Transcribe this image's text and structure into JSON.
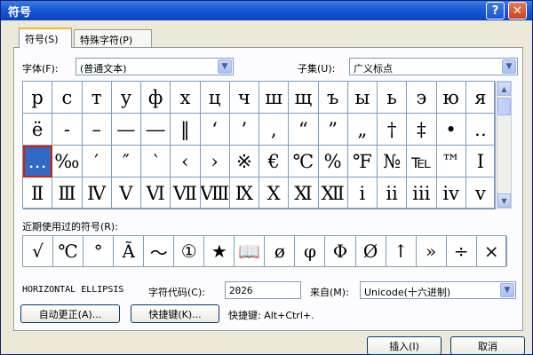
{
  "dialog": {
    "title": "符号",
    "help_glyph": "?",
    "close_glyph": "✕"
  },
  "tabs": [
    {
      "label": "符号(S)"
    },
    {
      "label": "特殊字符(P)"
    }
  ],
  "font": {
    "label": "字体(F):",
    "value": "(普通文本)"
  },
  "subset": {
    "label": "子集(U):",
    "value": "广义标点"
  },
  "symbols": [
    "р",
    "с",
    "т",
    "у",
    "ф",
    "х",
    "ц",
    "ч",
    "ш",
    "щ",
    "ъ",
    "ы",
    "ь",
    "э",
    "ю",
    "я",
    "ё",
    "‐",
    "–",
    "—",
    "―",
    "‖",
    "‘",
    "’",
    "‚",
    "“",
    "”",
    "„",
    "†",
    "‡",
    "•",
    "‥",
    "…",
    "‰",
    "′",
    "″",
    "‵",
    "‹",
    "›",
    "※",
    "€",
    "℃",
    "%",
    "℉",
    "№",
    "℡",
    "™",
    "Ⅰ",
    "Ⅱ",
    "Ⅲ",
    "Ⅳ",
    "Ⅴ",
    "Ⅵ",
    "Ⅶ",
    "Ⅷ",
    "Ⅸ",
    "Ⅹ",
    "Ⅺ",
    "Ⅻ",
    "ⅰ",
    "ⅱ",
    "ⅲ",
    "ⅳ",
    "ⅴ"
  ],
  "selected_index": 32,
  "recent": {
    "label": "近期使用过的符号(R):",
    "symbols": [
      "√",
      "℃",
      "°",
      "Ã",
      "～",
      "①",
      "★",
      "📖",
      "ø",
      "φ",
      "Φ",
      "Ø",
      "↑",
      "»",
      "÷",
      "×"
    ]
  },
  "char_name": "HORIZONTAL ELLIPSIS",
  "char_code": {
    "label": "字符代码(C):",
    "value": "2026"
  },
  "from": {
    "label": "来自(M):",
    "value": "Unicode(十六进制)"
  },
  "buttons": {
    "autocorrect": "自动更正(A)...",
    "shortcut": "快捷键(K)...",
    "insert": "插入(I)",
    "cancel": "取消"
  },
  "shortcut_text": "快捷键: Alt+Ctrl+."
}
